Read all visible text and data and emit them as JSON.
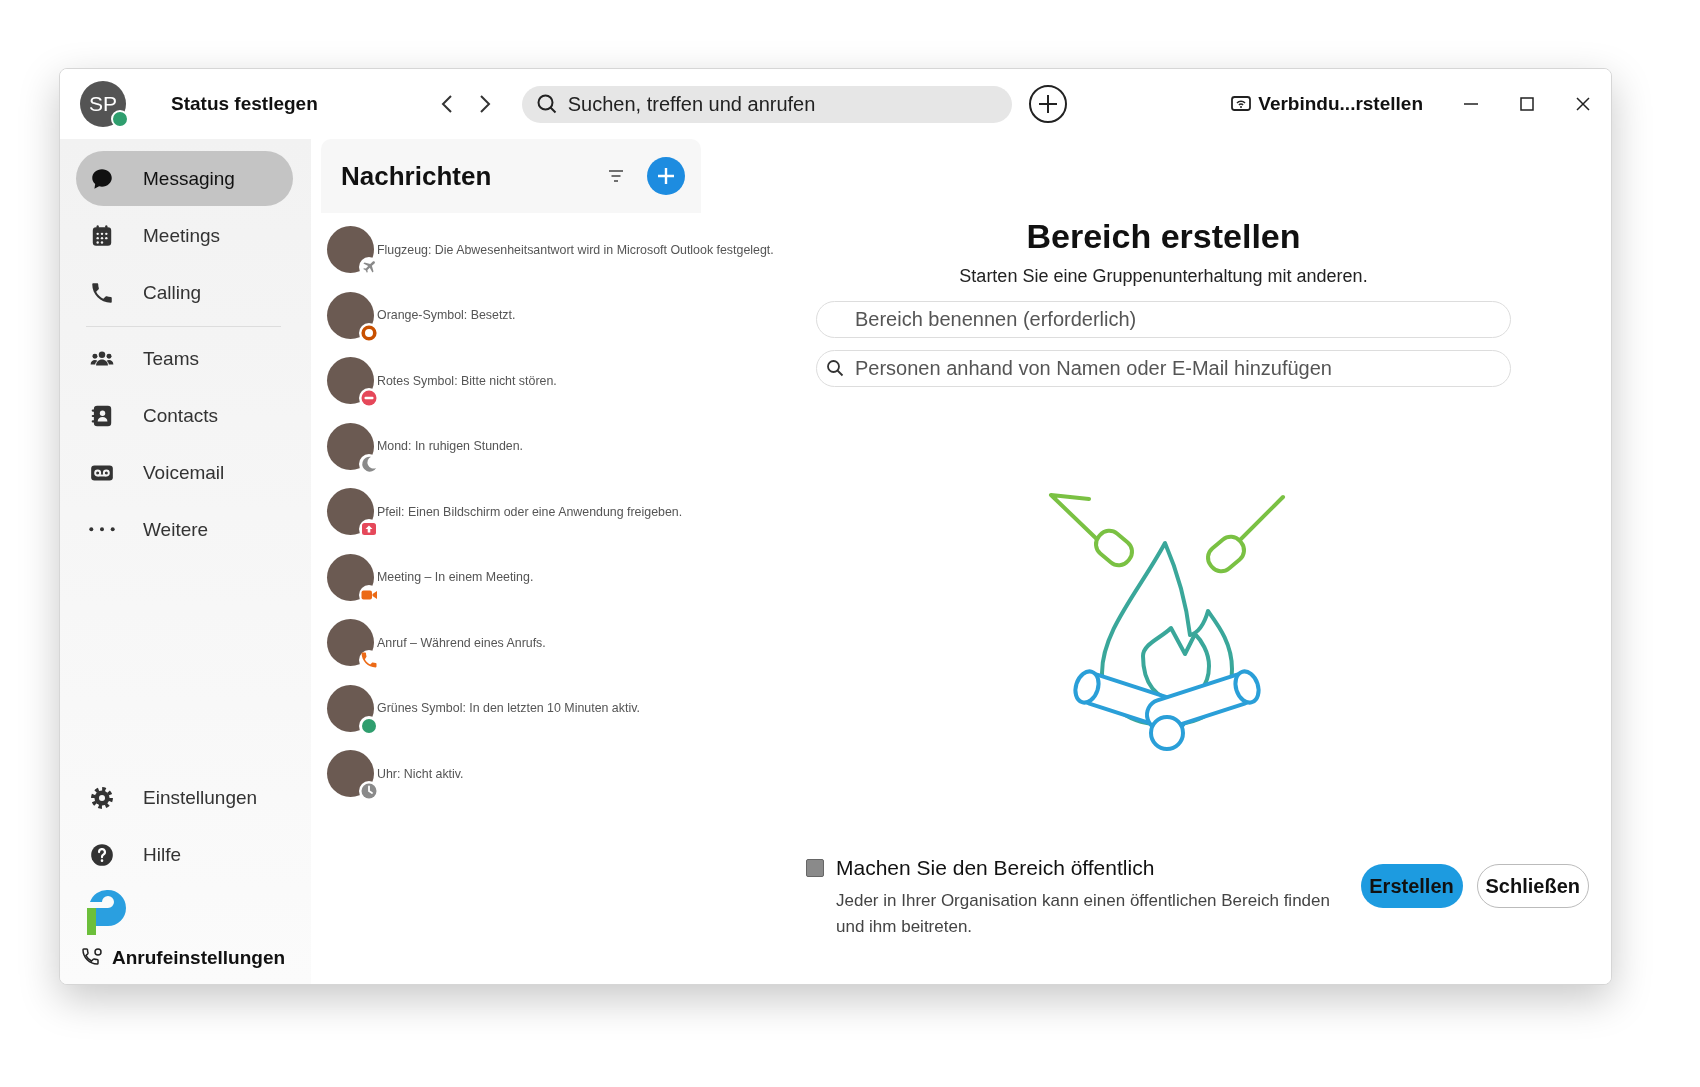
{
  "window": {
    "avatar": {
      "initials": "SP",
      "color": "#2f9e6e"
    },
    "status_label": "Status festlegen",
    "search": {
      "placeholder": "Suchen, treffen und anrufen"
    },
    "connect_label": "Verbindu...rstellen"
  },
  "sidebar": {
    "items": [
      {
        "label": "Messaging",
        "selected": true
      },
      {
        "label": "Meetings",
        "selected": false
      },
      {
        "label": "Calling",
        "selected": false
      },
      {
        "label": "Teams",
        "selected": false
      },
      {
        "label": "Contacts",
        "selected": false
      },
      {
        "label": "Voicemail",
        "selected": false
      },
      {
        "label": "Weitere",
        "selected": false
      }
    ],
    "bottom_items": [
      "Einstellungen",
      "Hilfe"
    ],
    "call_settings": "Anrufeinstellungen"
  },
  "messages": {
    "title": "Nachrichten",
    "items": [
      {
        "text": "Flugzeug: Die Abwesenheitsantwort wird in Microsoft Outlook festgelegt.",
        "kind": "airplane"
      },
      {
        "text": "Orange-Symbol: Besetzt.",
        "kind": "busy"
      },
      {
        "text": "Rotes Symbol: Bitte nicht stören.",
        "kind": "dnd"
      },
      {
        "text": "Mond: In ruhigen Stunden.",
        "kind": "moon"
      },
      {
        "text": "Pfeil: Einen Bildschirm oder eine Anwendung freigeben.",
        "kind": "share"
      },
      {
        "text": "Meeting – In einem Meeting.",
        "kind": "meeting"
      },
      {
        "text": "Anruf – Während eines Anrufs.",
        "kind": "call"
      },
      {
        "text": "Grünes Symbol: In den letzten 10 Minuten aktiv.",
        "kind": "active"
      },
      {
        "text": "Uhr: Nicht aktiv.",
        "kind": "clock"
      }
    ]
  },
  "create_space": {
    "title": "Bereich erstellen",
    "subtitle": "Starten Sie eine Gruppenunterhaltung mit anderen.",
    "name_field": {
      "placeholder": "Bereich benennen (erforderlich)"
    },
    "people_field": {
      "placeholder": "Personen anhand von Namen oder E-Mail hinzufügen"
    },
    "public_option": {
      "label": "Machen Sie den Bereich öffentlich",
      "description": "Jeder in Ihrer Organisation kann einen öffentlichen Bereich finden und ihm beitreten.",
      "checked": false
    },
    "buttons": [
      {
        "label": "Erstellen",
        "kind": "primary"
      },
      {
        "label": "Schließen",
        "kind": "secondary"
      }
    ]
  }
}
